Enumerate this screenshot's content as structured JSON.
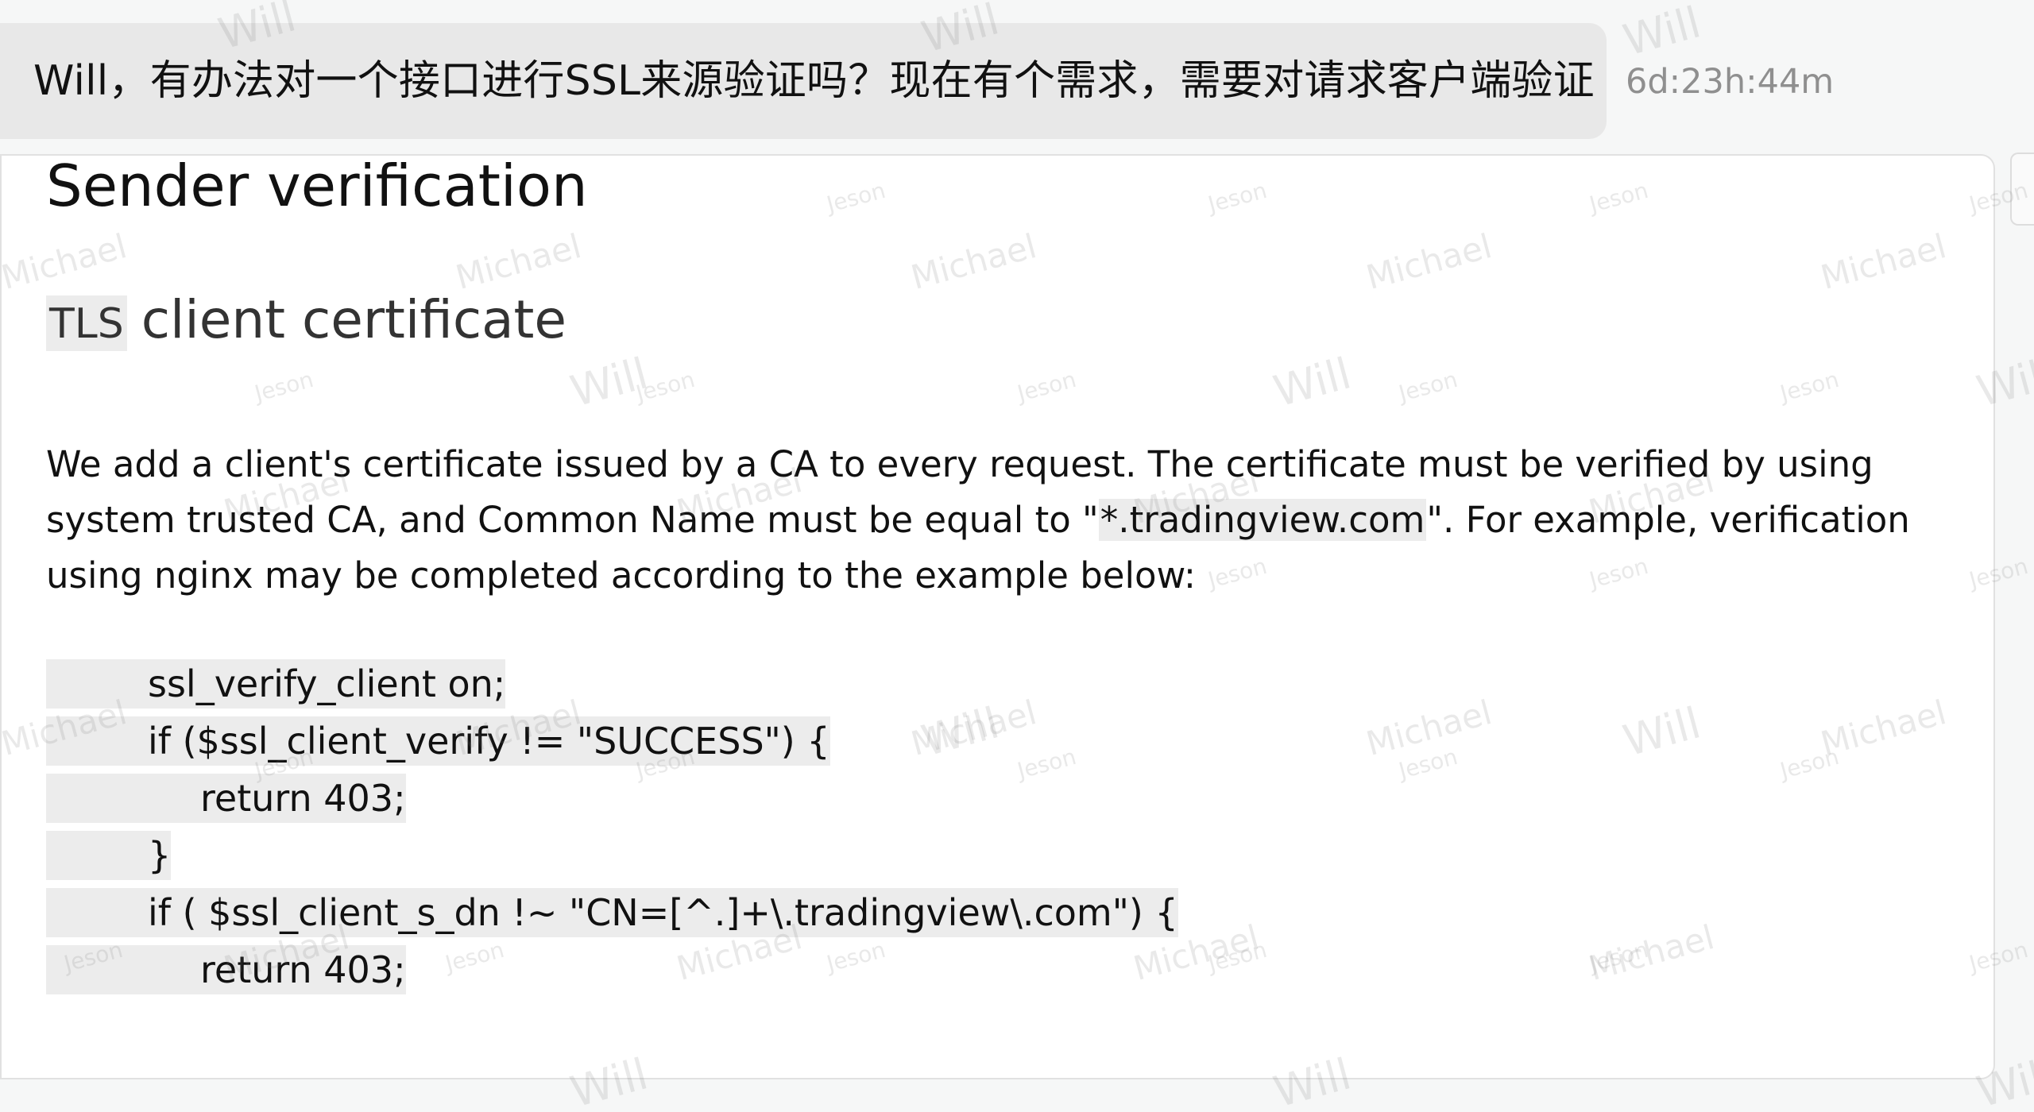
{
  "message": {
    "text": "Will，有办法对一个接口进行SSL来源验证吗？现在有个需求，需要对请求客户端验证",
    "time": "6d:23h:44m"
  },
  "document": {
    "title": "Sender verification",
    "subtitle_prefix": "TLS",
    "subtitle_rest": "client certificate",
    "paragraph": {
      "line1": "We add a client's certificate issued by a CA to every request. The certificate must be verified by using",
      "line2_start": "system trusted CA, and Common Name must be equal to \"",
      "line2_code": "*.tradingview.com",
      "line2_end": "\". For example, verification",
      "line3": "using nginx may be completed according to the example below:"
    },
    "code_lines": [
      "ssl_verify_client on;",
      "if ($ssl_client_verify != \"SUCCESS\") {",
      "return 403;",
      "}",
      "if ( $ssl_client_s_dn !~ \"CN=[^.]+\\.tradingview\\.com\") {",
      "return 403;"
    ]
  },
  "watermarks": {
    "names": [
      "Will",
      "Michael",
      "Jeson"
    ]
  },
  "colors": {
    "background": "#f6f7f7",
    "bubble": "#e8e8e8",
    "code_bg": "#ececec",
    "time_text": "#8f8f8f",
    "card_border": "#e1e1e1"
  }
}
